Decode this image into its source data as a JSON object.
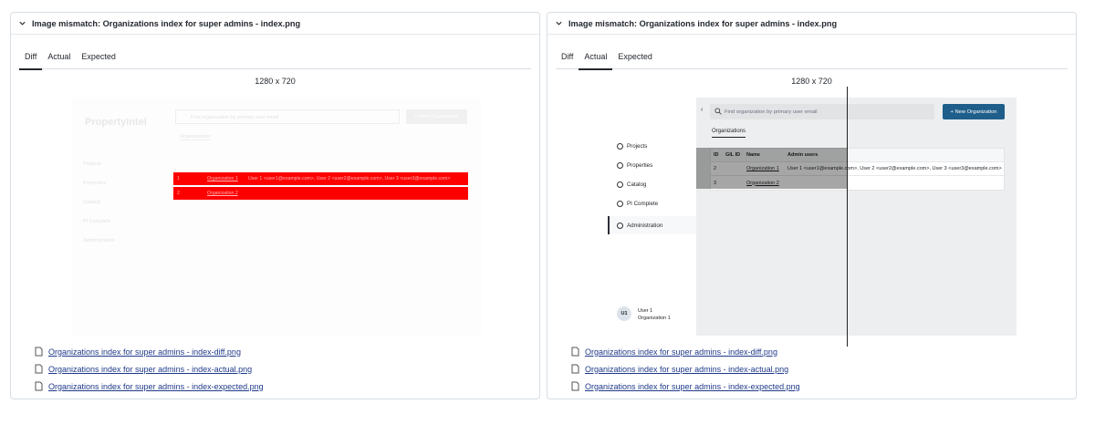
{
  "left_panel": {
    "title": "Image mismatch: Organizations index for super admins - index.png",
    "tabs": [
      "Diff",
      "Actual",
      "Expected"
    ],
    "active_tab": "Diff",
    "dimensions": "1280 x 720",
    "diff_shot": {
      "brand": "PropertyIntel",
      "search_placeholder": "Find organization by primary user email",
      "new_button": "+ New Organization",
      "subtab": "Organizations",
      "rows": [
        {
          "id": "1",
          "name": "Organization 1",
          "admins": "User 1 <user1@example.com>, User 2 <user2@example.com>, User 3 <user3@example.com>"
        },
        {
          "id": "2",
          "name": "Organization 2",
          "admins": ""
        }
      ],
      "nav": [
        "Projects",
        "Properties",
        "Catalog",
        "PI Complete",
        "Administration"
      ]
    },
    "files": [
      "Organizations index for super admins - index-diff.png",
      "Organizations index for super admins - index-actual.png",
      "Organizations index for super admins - index-expected.png"
    ]
  },
  "right_panel": {
    "title": "Image mismatch: Organizations index for super admins - index.png",
    "tabs": [
      "Diff",
      "Actual",
      "Expected"
    ],
    "active_tab": "Actual",
    "dimensions": "1280 x 720",
    "app": {
      "nav": [
        "Projects",
        "Properties",
        "Catalog",
        "PI Complete",
        "Administration"
      ],
      "search_placeholder": "Find organization by primary user email",
      "new_button": "+ New Organization",
      "subtab": "Organizations",
      "columns": [
        "ID",
        "GIL ID",
        "Name",
        "Admin users"
      ],
      "rows": [
        {
          "id": "2",
          "gil": "",
          "name": "Organization 1",
          "admins": "User 1 <user1@example.com>, User 2 <user2@example.com>, User 3 <user3@example.com>"
        },
        {
          "id": "3",
          "gil": "",
          "name": "Organization 2",
          "admins": ""
        }
      ],
      "user": {
        "initials": "U1",
        "name": "User 1",
        "org": "Organization 1"
      }
    },
    "files": [
      "Organizations index for super admins - index-diff.png",
      "Organizations index for super admins - index-actual.png",
      "Organizations index for super admins - index-expected.png"
    ]
  },
  "colors": {
    "diff_red": "#ff0000",
    "button_blue": "#1f5e8a",
    "link": "#1f3a8a"
  }
}
